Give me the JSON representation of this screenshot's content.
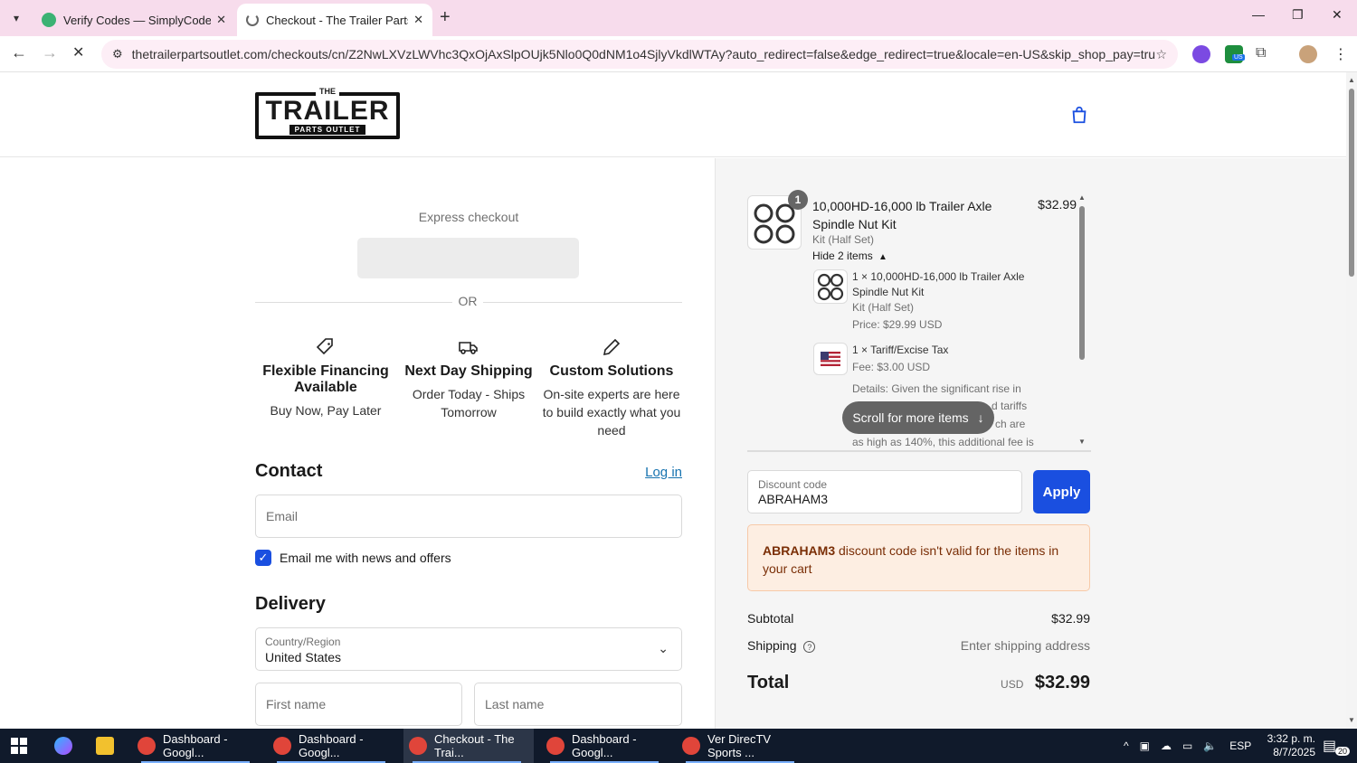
{
  "browser": {
    "tabs": [
      {
        "title": "Verify Codes — SimplyCodes",
        "active": false
      },
      {
        "title": "Checkout - The Trailer Parts Out",
        "active": true
      }
    ],
    "url": "thetrailerpartsoutlet.com/checkouts/cn/Z2NwLXVzLWVhc3QxOjAxSlpOUjk5Nlo0Q0dNM1o4SjlyVkdlWTAy?auto_redirect=false&edge_redirect=true&locale=en-US&skip_shop_pay=true",
    "extension_badge": "US"
  },
  "logo": {
    "the": "THE",
    "main": "TRAILER",
    "sub": "PARTS OUTLET"
  },
  "express": {
    "title": "Express checkout",
    "or": "OR"
  },
  "features": [
    {
      "icon": "tag-icon",
      "title": "Flexible Financing Available",
      "desc": "Buy Now, Pay Later"
    },
    {
      "icon": "truck-icon",
      "title": "Next Day Shipping",
      "desc": "Order Today - Ships Tomorrow"
    },
    {
      "icon": "pencil-icon",
      "title": "Custom Solutions",
      "desc": "On-site experts are here to build exactly what you need"
    }
  ],
  "contact": {
    "heading": "Contact",
    "login": "Log in",
    "email_placeholder": "Email",
    "newsletter_label": "Email me with news and offers",
    "newsletter_checked": true
  },
  "delivery": {
    "heading": "Delivery",
    "country_label": "Country/Region",
    "country_value": "United States",
    "first_name_placeholder": "First name",
    "last_name_placeholder": "Last name"
  },
  "cart": {
    "qty_badge": "1",
    "product_name": "10,000HD-16,000 lb Trailer Axle Spindle Nut Kit",
    "product_variant": "Kit (Half Set)",
    "product_price": "$32.99",
    "hide_items": "Hide 2 items",
    "sub_items": [
      {
        "name": "1 × 10,000HD-16,000 lb Trailer Axle Spindle Nut Kit",
        "variant": "Kit (Half Set)",
        "price": "Price: $29.99 USD"
      },
      {
        "name": "1 × Tariff/Excise Tax",
        "price": "Fee: $3.00 USD",
        "details_l1": "Details: Given the significant rise in",
        "details_l2": "d tariffs",
        "details_l3": "ch are",
        "details_l4": "as high as 140%, this additional fee is"
      }
    ],
    "scroll_hint": "Scroll for more items"
  },
  "discount": {
    "label": "Discount code",
    "value": "ABRAHAM3",
    "apply": "Apply",
    "error_code": "ABRAHAM3",
    "error_msg": " discount code isn't valid for the items in your cart"
  },
  "summary": {
    "subtotal_label": "Subtotal",
    "subtotal_value": "$32.99",
    "shipping_label": "Shipping",
    "shipping_value": "Enter shipping address",
    "total_label": "Total",
    "total_currency": "USD",
    "total_value": "$32.99"
  },
  "taskbar": {
    "apps": [
      {
        "label": "Dashboard - Googl..."
      },
      {
        "label": "Dashboard - Googl..."
      },
      {
        "label": "Checkout - The Trai..."
      },
      {
        "label": "Dashboard - Googl..."
      },
      {
        "label": "Ver DirecTV Sports ..."
      }
    ],
    "lang": "ESP",
    "time": "3:32 p. m.",
    "date": "8/7/2025",
    "notif_count": "20"
  },
  "colors": {
    "accent": "#1a4fe0",
    "tabbar": "#f7dcec",
    "error_bg": "#fdeee2",
    "link": "#1773b0"
  }
}
